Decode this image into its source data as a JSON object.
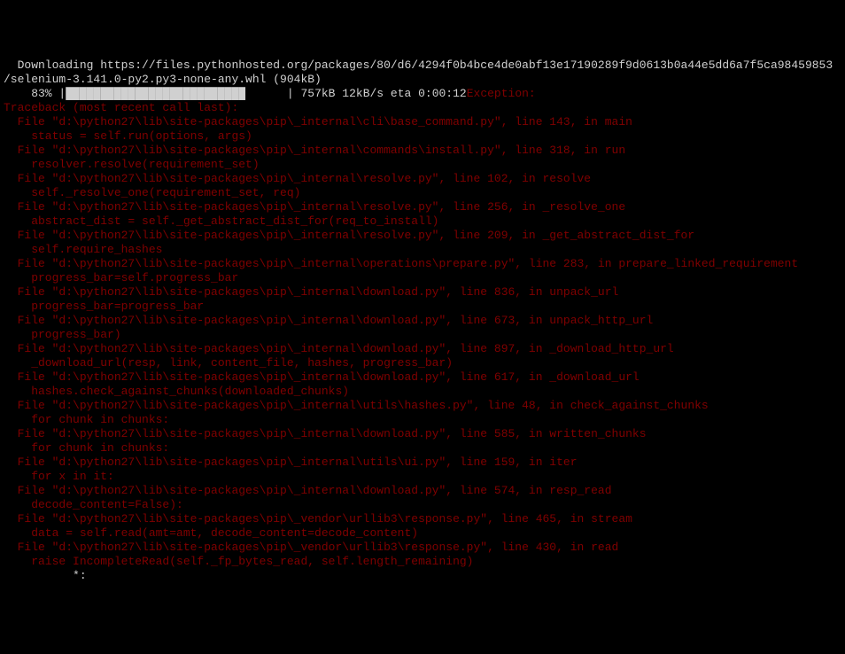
{
  "download_line1": "  Downloading https://files.pythonhosted.org/packages/80/d6/4294f0b4bce4de0abf13e17190289f9d0613b0a44e5dd6a7f5ca98459853",
  "download_line2": "/selenium-3.141.0-py2.py3-none-any.whl (904kB)",
  "progress_percent": "    83% ",
  "progress_filled": "|██████████████████████████",
  "progress_empty": "      ",
  "progress_stats": "| 757kB 12kB/s eta 0:00:12",
  "exception_label": "Exception:",
  "traceback_header": "Traceback (most recent call last):",
  "frames": [
    {
      "file": "  File \"d:\\python27\\lib\\site-packages\\pip\\_internal\\cli\\base_command.py\", line 143, in main",
      "code": "    status = self.run(options, args)"
    },
    {
      "file": "  File \"d:\\python27\\lib\\site-packages\\pip\\_internal\\commands\\install.py\", line 318, in run",
      "code": "    resolver.resolve(requirement_set)"
    },
    {
      "file": "  File \"d:\\python27\\lib\\site-packages\\pip\\_internal\\resolve.py\", line 102, in resolve",
      "code": "    self._resolve_one(requirement_set, req)"
    },
    {
      "file": "  File \"d:\\python27\\lib\\site-packages\\pip\\_internal\\resolve.py\", line 256, in _resolve_one",
      "code": "    abstract_dist = self._get_abstract_dist_for(req_to_install)"
    },
    {
      "file": "  File \"d:\\python27\\lib\\site-packages\\pip\\_internal\\resolve.py\", line 209, in _get_abstract_dist_for",
      "code": "    self.require_hashes"
    },
    {
      "file": "  File \"d:\\python27\\lib\\site-packages\\pip\\_internal\\operations\\prepare.py\", line 283, in prepare_linked_requirement",
      "code": "    progress_bar=self.progress_bar"
    },
    {
      "file": "  File \"d:\\python27\\lib\\site-packages\\pip\\_internal\\download.py\", line 836, in unpack_url",
      "code": "    progress_bar=progress_bar"
    },
    {
      "file": "  File \"d:\\python27\\lib\\site-packages\\pip\\_internal\\download.py\", line 673, in unpack_http_url",
      "code": "    progress_bar)"
    },
    {
      "file": "  File \"d:\\python27\\lib\\site-packages\\pip\\_internal\\download.py\", line 897, in _download_http_url",
      "code": "    _download_url(resp, link, content_file, hashes, progress_bar)"
    },
    {
      "file": "  File \"d:\\python27\\lib\\site-packages\\pip\\_internal\\download.py\", line 617, in _download_url",
      "code": "    hashes.check_against_chunks(downloaded_chunks)"
    },
    {
      "file": "  File \"d:\\python27\\lib\\site-packages\\pip\\_internal\\utils\\hashes.py\", line 48, in check_against_chunks",
      "code": "    for chunk in chunks:"
    },
    {
      "file": "  File \"d:\\python27\\lib\\site-packages\\pip\\_internal\\download.py\", line 585, in written_chunks",
      "code": "    for chunk in chunks:"
    },
    {
      "file": "  File \"d:\\python27\\lib\\site-packages\\pip\\_internal\\utils\\ui.py\", line 159, in iter",
      "code": "    for x in it:"
    },
    {
      "file": "  File \"d:\\python27\\lib\\site-packages\\pip\\_internal\\download.py\", line 574, in resp_read",
      "code": "    decode_content=False):"
    },
    {
      "file": "  File \"d:\\python27\\lib\\site-packages\\pip\\_vendor\\urllib3\\response.py\", line 465, in stream",
      "code": "    data = self.read(amt=amt, decode_content=decode_content)"
    },
    {
      "file": "  File \"d:\\python27\\lib\\site-packages\\pip\\_vendor\\urllib3\\response.py\", line 430, in read",
      "code": "    raise IncompleteRead(self._fp_bytes_read, self.length_remaining)"
    }
  ],
  "cursor_line": "          *:"
}
